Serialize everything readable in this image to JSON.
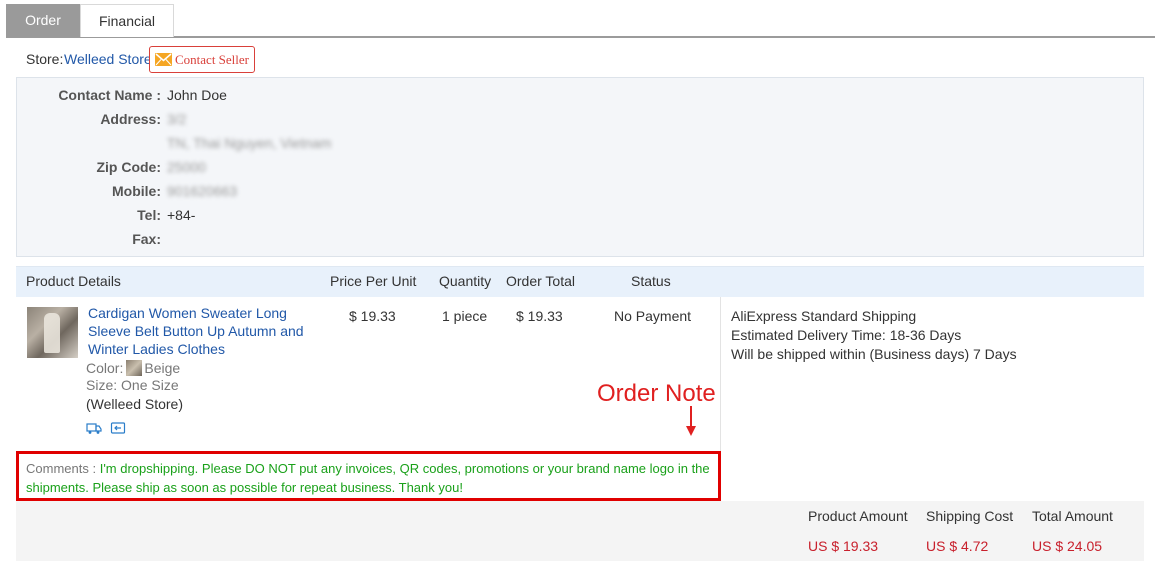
{
  "tabs": {
    "order": "Order",
    "financial": "Financial"
  },
  "store": {
    "label": "Store:",
    "name": "Welleed Store",
    "contact_label": "Contact Seller"
  },
  "address": {
    "contact_name_label": "Contact Name :",
    "contact_name": "John Doe",
    "address_label": "Address:",
    "address_line1": "3/2",
    "address_line2": "TN, Thai Nguyen, Vietnam",
    "zip_label": "Zip Code:",
    "zip": "25000",
    "mobile_label": "Mobile:",
    "mobile": "901620663",
    "tel_label": "Tel:",
    "tel": "+84-",
    "fax_label": "Fax:",
    "fax": ""
  },
  "table": {
    "headers": {
      "product": "Product Details",
      "price": "Price Per Unit",
      "quantity": "Quantity",
      "total": "Order Total",
      "status": "Status"
    }
  },
  "product": {
    "title": "Cardigan Women Sweater Long Sleeve Belt Button Up Autumn and Winter Ladies Clothes",
    "color_label": "Color:",
    "color": "Beige",
    "size_label": "Size:",
    "size": "One Size",
    "store_note": "(Welleed Store)",
    "price": "$ 19.33",
    "quantity": "1 piece",
    "total": "$ 19.33",
    "status": "No Payment"
  },
  "shipping": {
    "method": "AliExpress Standard Shipping",
    "delivery": "Estimated Delivery Time: 18-36 Days",
    "ship_within": "Will be shipped within (Business days) 7 Days"
  },
  "annotation": {
    "label": "Order Note",
    "color": "#e02020"
  },
  "comment": {
    "label": "Comments :",
    "text": "I'm dropshipping. Please DO NOT put any invoices, QR codes, promotions or your brand name logo in the shipments. Please ship as soon as possible for repeat business. Thank you!"
  },
  "totals": {
    "product_amount_label": "Product Amount",
    "product_amount": "US $ 19.33",
    "shipping_cost_label": "Shipping Cost",
    "shipping_cost": "US $ 4.72",
    "total_amount_label": "Total Amount",
    "total_amount": "US $ 24.05"
  },
  "colors": {
    "link": "#2158a8",
    "price": "#c8202c",
    "comment": "#1aa11a",
    "highlight_border": "#e00000"
  }
}
